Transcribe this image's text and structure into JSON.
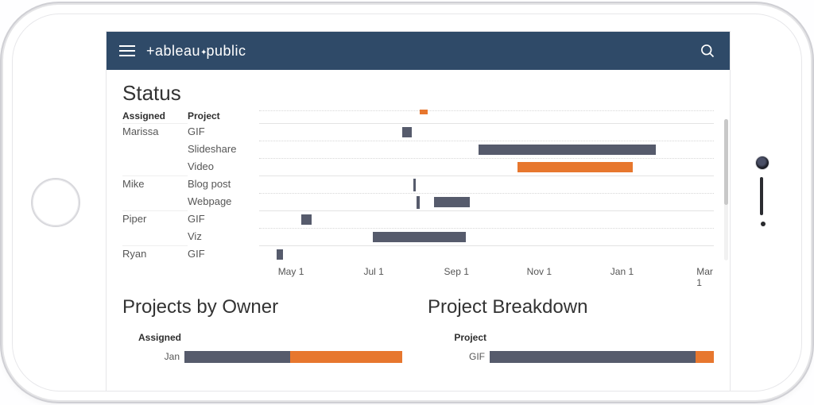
{
  "brand": {
    "left": "+ableau",
    "right": "public"
  },
  "titles": {
    "status": "Status",
    "projects_by_owner": "Projects by Owner",
    "project_breakdown": "Project Breakdown"
  },
  "headers": {
    "assigned": "Assigned",
    "project": "Project"
  },
  "colors": {
    "grey": "#565b6c",
    "orange": "#e7772e",
    "bar_bg": "#2f4a68"
  },
  "chart_data": {
    "status_gantt": {
      "type": "bar",
      "orientation": "horizontal-timeline",
      "x_axis_ticks": [
        "May 1",
        "Jul 1",
        "Sep 1",
        "Nov 1",
        "Jan 1",
        "Mar 1"
      ],
      "x_range_months": [
        "Apr",
        "Mar"
      ],
      "extra_marker": {
        "color": "orange",
        "start_pct": 35.3,
        "width_pct": 1.8,
        "row": "above"
      },
      "rows": [
        {
          "assigned": "Marissa",
          "project": "GIF",
          "bars": [
            {
              "color": "grey",
              "start_pct": 31.5,
              "width_pct": 2.0
            }
          ]
        },
        {
          "assigned": "",
          "project": "Slideshare",
          "bars": [
            {
              "color": "grey",
              "start_pct": 48.2,
              "width_pct": 39.0
            }
          ]
        },
        {
          "assigned": "",
          "project": "Video",
          "bars": [
            {
              "color": "orange",
              "start_pct": 56.8,
              "width_pct": 25.3
            }
          ]
        },
        {
          "assigned": "Mike",
          "project": "Blog post",
          "bars": [
            {
              "color": "grey",
              "start_pct": 34.0,
              "width_pct": 0.4,
              "thin": true
            }
          ]
        },
        {
          "assigned": "",
          "project": "Webpage",
          "bars": [
            {
              "color": "grey",
              "start_pct": 34.6,
              "width_pct": 0.8,
              "thin": true
            },
            {
              "color": "grey",
              "start_pct": 38.5,
              "width_pct": 7.8
            }
          ]
        },
        {
          "assigned": "Piper",
          "project": "GIF",
          "bars": [
            {
              "color": "grey",
              "start_pct": 9.3,
              "width_pct": 2.3
            }
          ]
        },
        {
          "assigned": "",
          "project": "Viz",
          "bars": [
            {
              "color": "grey",
              "start_pct": 25.0,
              "width_pct": 20.5
            }
          ]
        },
        {
          "assigned": "Ryan",
          "project": "GIF",
          "bars": [
            {
              "color": "grey",
              "start_pct": 3.8,
              "width_pct": 1.5
            }
          ]
        }
      ]
    },
    "projects_by_owner": {
      "type": "bar",
      "header": "Assigned",
      "rows": [
        {
          "label": "Jan",
          "segments": [
            {
              "color": "grey",
              "start_pct": 0,
              "width_pct": 47
            },
            {
              "color": "orange",
              "start_pct": 47,
              "width_pct": 50
            }
          ]
        }
      ]
    },
    "project_breakdown": {
      "type": "bar",
      "header": "Project",
      "rows": [
        {
          "label": "GIF",
          "segments": [
            {
              "color": "grey",
              "start_pct": 0,
              "width_pct": 92
            },
            {
              "color": "orange",
              "start_pct": 92,
              "width_pct": 8
            }
          ]
        }
      ]
    }
  }
}
